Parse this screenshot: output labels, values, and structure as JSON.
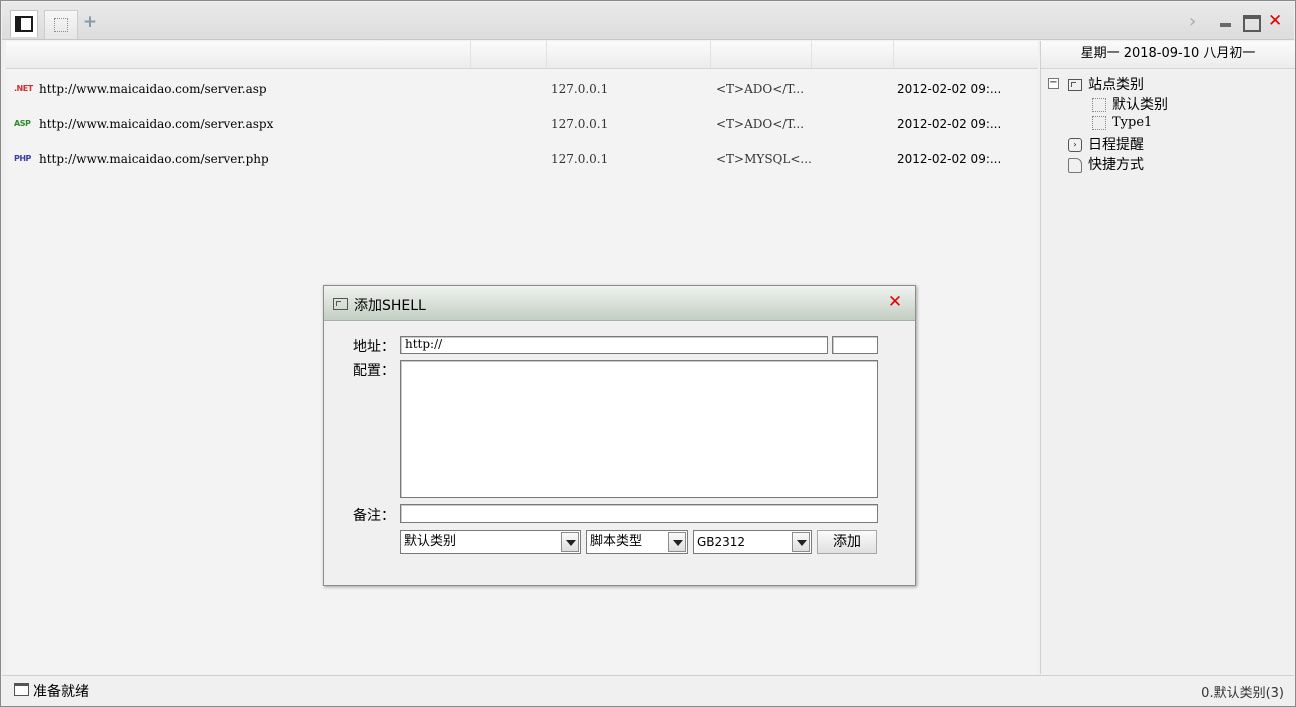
{
  "tabs": {
    "add_symbol": "+"
  },
  "window_controls": {
    "next_symbol": "›",
    "close_symbol": "✕"
  },
  "date_display": "星期一 2018-09-10 八月初一",
  "shells": [
    {
      "type_icon": ".NET",
      "icon_color": "#d23030",
      "url": "http://www.maicaidao.com/server.asp",
      "ip": "127.0.0.1",
      "config": "<T>ADO</T...",
      "datetime": "2012-02-02 09:..."
    },
    {
      "type_icon": "ASP",
      "icon_color": "#2f8a2f",
      "url": "http://www.maicaidao.com/server.aspx",
      "ip": "127.0.0.1",
      "config": "<T>ADO</T...",
      "datetime": "2012-02-02 09:..."
    },
    {
      "type_icon": "PHP",
      "icon_color": "#3b3fa8",
      "url": "http://www.maicaidao.com/server.php",
      "ip": "127.0.0.1",
      "config": "<T>MYSQL<...",
      "datetime": "2012-02-02 09:..."
    }
  ],
  "tree": {
    "expander": "−",
    "root_label": "站点类别",
    "children": [
      "默认类别",
      "Type1"
    ],
    "schedule_label": "日程提醒",
    "shortcut_label": "快捷方式"
  },
  "dialog": {
    "title": "添加SHELL",
    "close_symbol": "✕",
    "address_label": "地址：",
    "address_value": "http://",
    "config_label": "配置：",
    "note_label": "备注：",
    "category_select": "默认类别",
    "script_select": "脚本类型",
    "encoding_select": "GB2312",
    "add_button": "添加"
  },
  "status": {
    "left_text": "准备就绪",
    "right_text": "0.默认类别(3)"
  }
}
